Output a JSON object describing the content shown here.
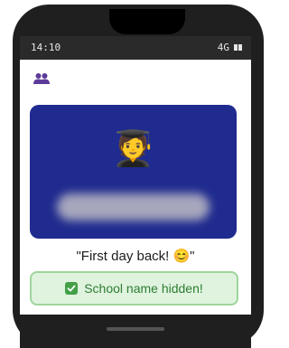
{
  "status_bar": {
    "time": "14:10",
    "network": "4G",
    "battery_icon": "battery-icon"
  },
  "header": {
    "icon": "group-icon",
    "icon_color": "#5b3a99"
  },
  "card": {
    "background": "#1f2b8e",
    "image_emoji": "🧑‍🎓",
    "hidden_text_state": "blurred"
  },
  "post": {
    "caption": "\"First day back! 😊\""
  },
  "toast": {
    "icon": "check-icon",
    "message": "School name hidden!",
    "accent": "#43a047"
  }
}
